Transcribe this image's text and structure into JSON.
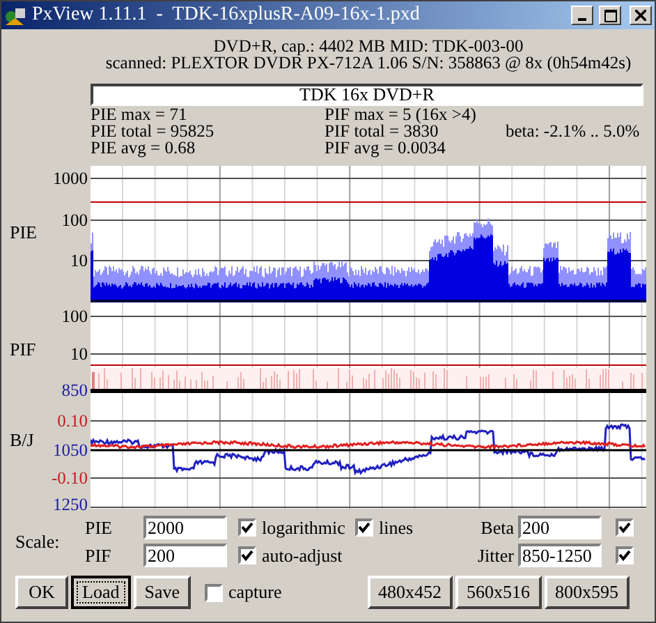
{
  "window": {
    "title": "PxView 1.11.1  -  TDK-16xplusR-A09-16x-1.pxd"
  },
  "header": [
    "DVD+R, cap.: 4402 MB MID: TDK-003-00",
    "scanned: PLEXTOR DVDR PX-712A 1.06 S/N: 358863 @ 8x (0h54m42s)"
  ],
  "disc_label": {
    "value": "TDK 16x DVD+R"
  },
  "stats": {
    "pie": [
      "PIE max = 71",
      "PIE total = 95825",
      "PIE avg = 0.68"
    ],
    "pif": [
      "PIF max = 5 (16x >4)",
      "PIF total = 3830",
      "PIF avg = 0.0034"
    ],
    "beta": "beta: -2.1% .. 5.0%"
  },
  "panels": [
    {
      "kind": "pie",
      "label": "PIE",
      "ticks": [
        {
          "label": "1000",
          "color": "#000000"
        },
        {
          "label": "100",
          "color": "#000000"
        },
        {
          "label": "10",
          "color": "#000000"
        }
      ]
    },
    {
      "kind": "pif",
      "label": "PIF",
      "ticks": [
        {
          "label": "100",
          "color": "#000000"
        },
        {
          "label": "10",
          "color": "#000000"
        },
        {
          "label": "850",
          "color": "#1c1ca0"
        }
      ]
    },
    {
      "kind": "bj",
      "label": "B/J",
      "ticks": [
        {
          "label": "0.10",
          "color": "#c02020"
        },
        {
          "label": "1050",
          "color": "#1c1ca0"
        },
        {
          "label": "-0.10",
          "color": "#c02020"
        },
        {
          "label": "1250",
          "color": "#1c1ca0"
        }
      ]
    }
  ],
  "scale": {
    "label": "Scale:",
    "fields": [
      {
        "label": "PIE",
        "value": "2000"
      },
      {
        "label": "PIF",
        "value": "200"
      }
    ],
    "options": [
      {
        "label": "logarithmic",
        "checked": true
      },
      {
        "label": "lines",
        "checked": true
      },
      {
        "label": "auto-adjust",
        "checked": true
      }
    ],
    "beta": {
      "label": "Beta",
      "value": "200",
      "checked": true
    },
    "jitter": {
      "label": "Jitter",
      "value": "850-1250",
      "checked": true
    }
  },
  "buttons": [
    {
      "label": "OK",
      "focused": false
    },
    {
      "label": "Load",
      "focused": true
    },
    {
      "label": "Save",
      "focused": false
    }
  ],
  "capture": {
    "label": "capture",
    "checked": false
  },
  "size_buttons": [
    "480x452",
    "560x516",
    "800x595"
  ]
}
